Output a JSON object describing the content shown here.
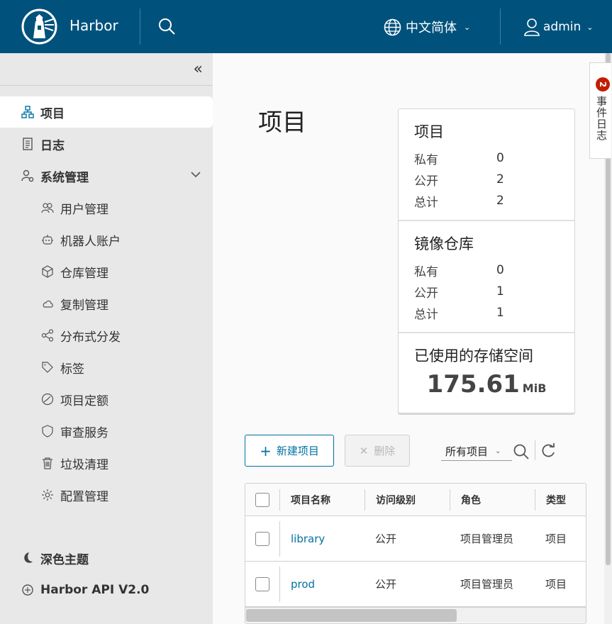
{
  "header": {
    "brand": "Harbor",
    "language": "中文简体",
    "user": "admin",
    "colors": {
      "bar": "#00527d",
      "accent": "#0072a3"
    }
  },
  "sidebar": {
    "collapse_icon": "double-chevron-left-icon",
    "items": [
      {
        "label": "项目",
        "icon": "projects-icon",
        "active": true
      },
      {
        "label": "日志",
        "icon": "logs-icon"
      },
      {
        "label": "系统管理",
        "icon": "admin-icon",
        "expanded": true
      }
    ],
    "sub_items": [
      {
        "label": "用户管理",
        "icon": "users-icon"
      },
      {
        "label": "机器人账户",
        "icon": "robot-icon"
      },
      {
        "label": "仓库管理",
        "icon": "registry-icon"
      },
      {
        "label": "复制管理",
        "icon": "cloud-icon"
      },
      {
        "label": "分布式分发",
        "icon": "share-icon"
      },
      {
        "label": "标签",
        "icon": "tag-icon"
      },
      {
        "label": "项目定额",
        "icon": "gauge-icon"
      },
      {
        "label": "审查服务",
        "icon": "shield-icon"
      },
      {
        "label": "垃圾清理",
        "icon": "trash-icon"
      },
      {
        "label": "配置管理",
        "icon": "gear-icon"
      }
    ],
    "footer": [
      {
        "label": "深色主题",
        "icon": "moon-icon"
      },
      {
        "label": "Harbor API V2.0",
        "icon": "api-icon"
      }
    ]
  },
  "main": {
    "title": "项目",
    "stats": {
      "projects": {
        "title": "项目",
        "rows": [
          {
            "label": "私有",
            "value": "0"
          },
          {
            "label": "公开",
            "value": "2"
          },
          {
            "label": "总计",
            "value": "2"
          }
        ]
      },
      "repos": {
        "title": "镜像仓库",
        "rows": [
          {
            "label": "私有",
            "value": "0"
          },
          {
            "label": "公开",
            "value": "1"
          },
          {
            "label": "总计",
            "value": "1"
          }
        ]
      },
      "storage": {
        "title": "已使用的存储空间",
        "value": "175.61",
        "unit": "MiB"
      }
    },
    "toolbar": {
      "new_label": "新建项目",
      "delete_label": "删除",
      "filter_value": "所有项目"
    },
    "table": {
      "headers": [
        "项目名称",
        "访问级别",
        "角色",
        "类型"
      ],
      "rows": [
        {
          "name": "library",
          "access": "公开",
          "role": "项目管理员",
          "type": "项目"
        },
        {
          "name": "prod",
          "access": "公开",
          "role": "项目管理员",
          "type": "项目"
        }
      ]
    }
  },
  "event_log": {
    "label": "事件日志",
    "count": "2"
  }
}
